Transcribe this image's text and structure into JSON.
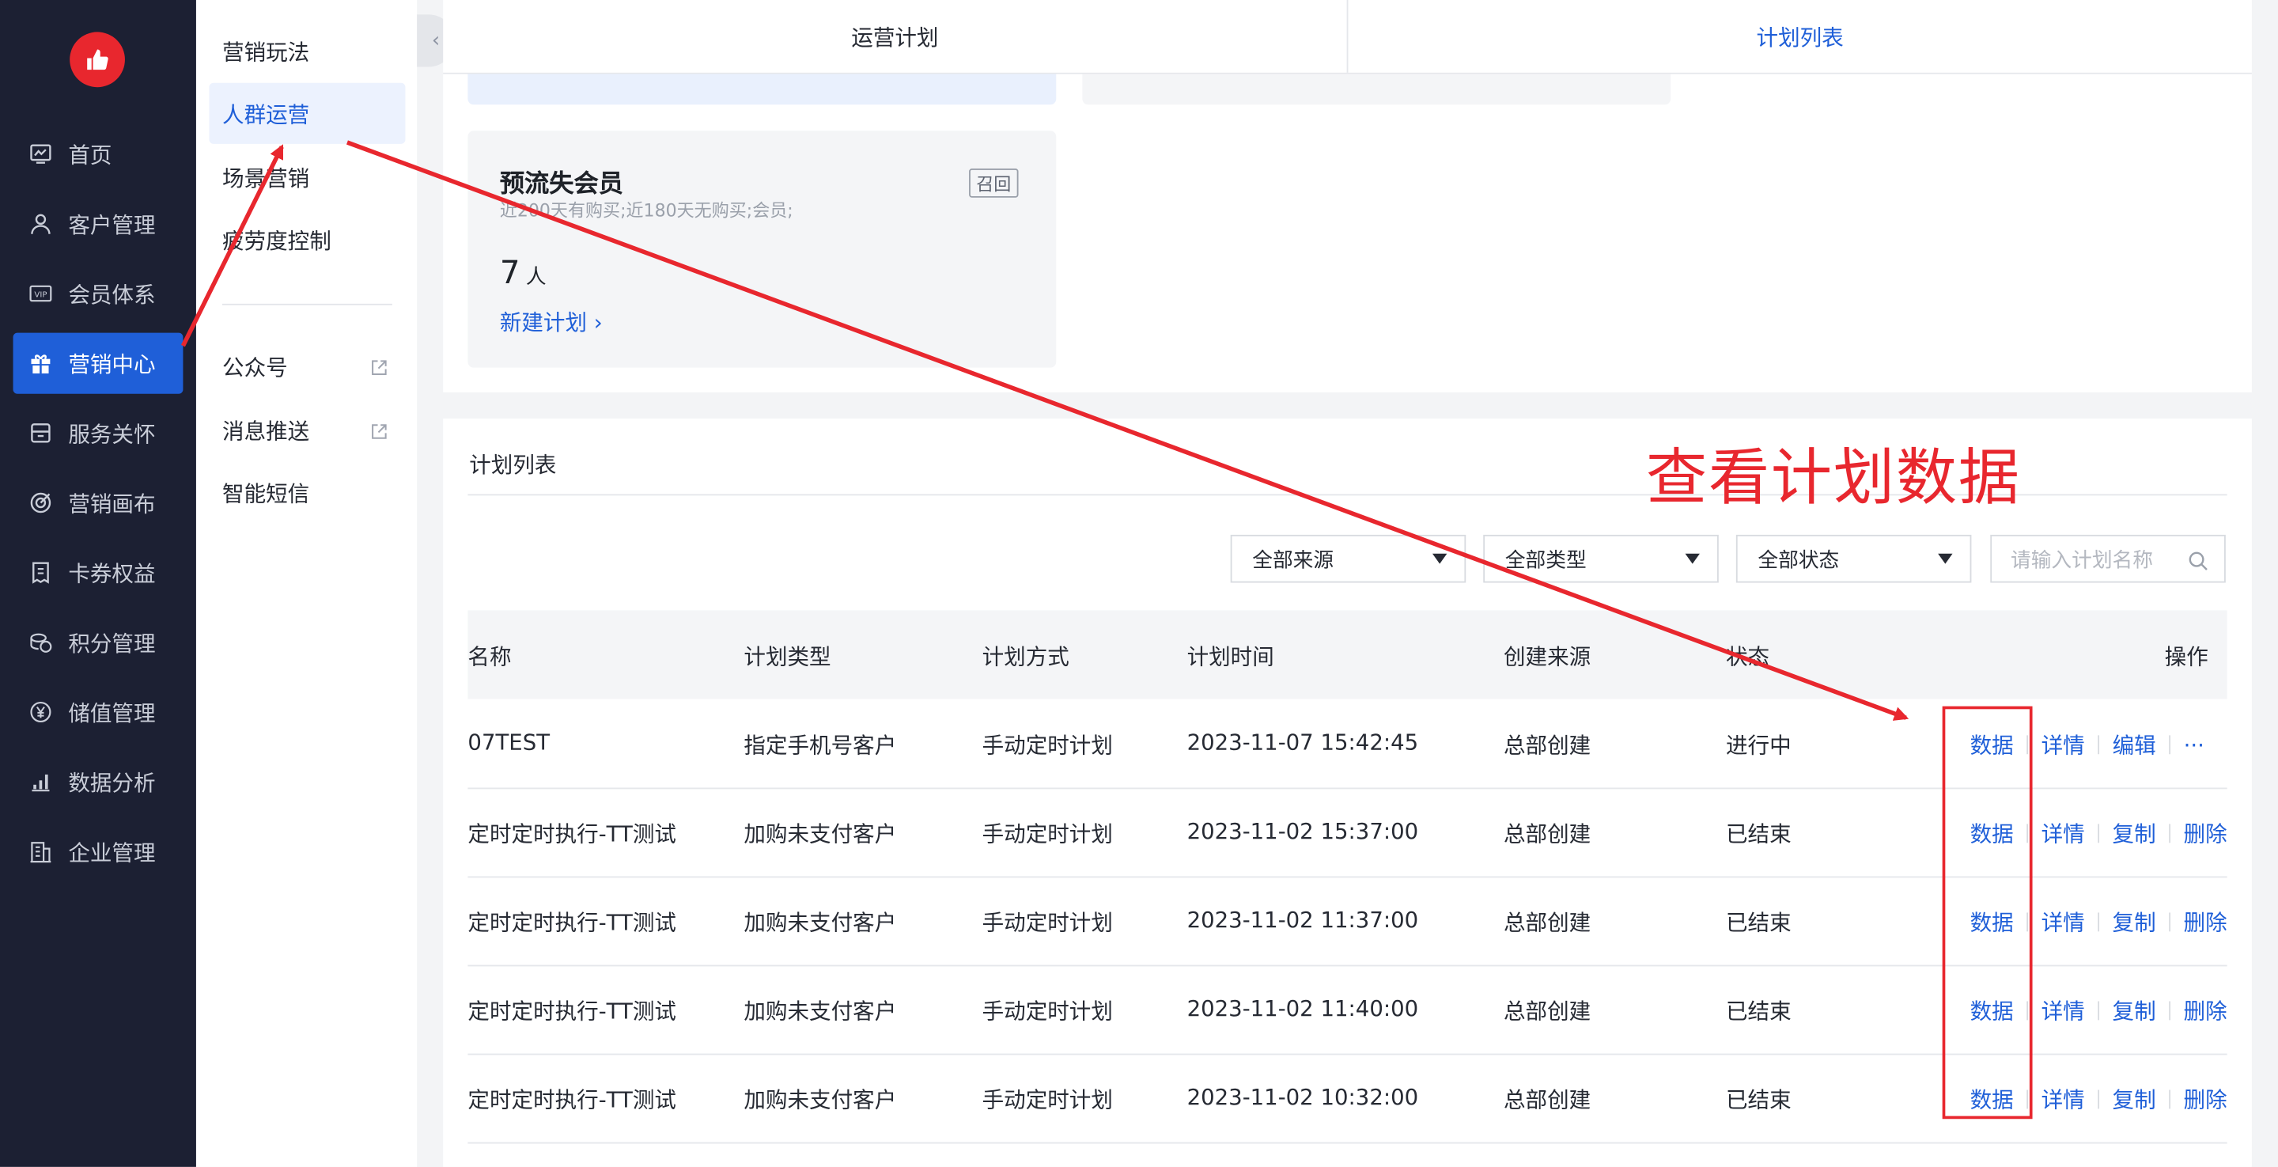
{
  "sidebar": {
    "items": [
      {
        "label": "首页",
        "icon": "dashboard-icon"
      },
      {
        "label": "客户管理",
        "icon": "user-icon"
      },
      {
        "label": "会员体系",
        "icon": "vip-icon"
      },
      {
        "label": "营销中心",
        "icon": "gift-icon",
        "active": true
      },
      {
        "label": "服务关怀",
        "icon": "service-icon"
      },
      {
        "label": "营销画布",
        "icon": "target-icon"
      },
      {
        "label": "卡券权益",
        "icon": "coupon-icon"
      },
      {
        "label": "积分管理",
        "icon": "coins-icon"
      },
      {
        "label": "储值管理",
        "icon": "yen-icon"
      },
      {
        "label": "数据分析",
        "icon": "bar-chart-icon"
      },
      {
        "label": "企业管理",
        "icon": "building-icon"
      }
    ]
  },
  "subnav": {
    "items": [
      "营销玩法",
      "人群运营",
      "场景营销",
      "疲劳度控制"
    ],
    "active_index": 1,
    "external_items": [
      "公众号",
      "消息推送"
    ],
    "extra_item": "智能短信"
  },
  "tabs": [
    "运营计划",
    "计划列表"
  ],
  "card": {
    "title": "预流失会员",
    "tag": "召回",
    "desc": "近200天有购买;近180天无购买;会员;",
    "count": "7",
    "unit": "人",
    "link": "新建计划 ›"
  },
  "plan_list": {
    "title": "计划列表",
    "filters": [
      "全部来源",
      "全部类型",
      "全部状态"
    ],
    "search_placeholder": "请输入计划名称",
    "columns": [
      "名称",
      "计划类型",
      "计划方式",
      "计划时间",
      "创建来源",
      "状态",
      "操作"
    ],
    "rows": [
      {
        "name": "07TEST",
        "type": "指定手机号客户",
        "mode": "手动定时计划",
        "time": "2023-11-07 15:42:45",
        "source": "总部创建",
        "status": "进行中",
        "ops": [
          "数据",
          "详情",
          "编辑",
          "···"
        ]
      },
      {
        "name": "定时定时执行-TT测试",
        "type": "加购未支付客户",
        "mode": "手动定时计划",
        "time": "2023-11-02 15:37:00",
        "source": "总部创建",
        "status": "已结束",
        "ops": [
          "数据",
          "详情",
          "复制",
          "删除"
        ]
      },
      {
        "name": "定时定时执行-TT测试",
        "type": "加购未支付客户",
        "mode": "手动定时计划",
        "time": "2023-11-02 11:37:00",
        "source": "总部创建",
        "status": "已结束",
        "ops": [
          "数据",
          "详情",
          "复制",
          "删除"
        ]
      },
      {
        "name": "定时定时执行-TT测试",
        "type": "加购未支付客户",
        "mode": "手动定时计划",
        "time": "2023-11-02 11:40:00",
        "source": "总部创建",
        "status": "已结束",
        "ops": [
          "数据",
          "详情",
          "复制",
          "删除"
        ]
      },
      {
        "name": "定时定时执行-TT测试",
        "type": "加购未支付客户",
        "mode": "手动定时计划",
        "time": "2023-11-02 10:32:00",
        "source": "总部创建",
        "status": "已结束",
        "ops": [
          "数据",
          "详情",
          "复制",
          "删除"
        ]
      }
    ]
  },
  "annotation": {
    "text": "查看计划数据",
    "color": "#e8272e"
  },
  "colors": {
    "primary": "#1f5fd8",
    "sidebar_bg": "#1c2033"
  }
}
